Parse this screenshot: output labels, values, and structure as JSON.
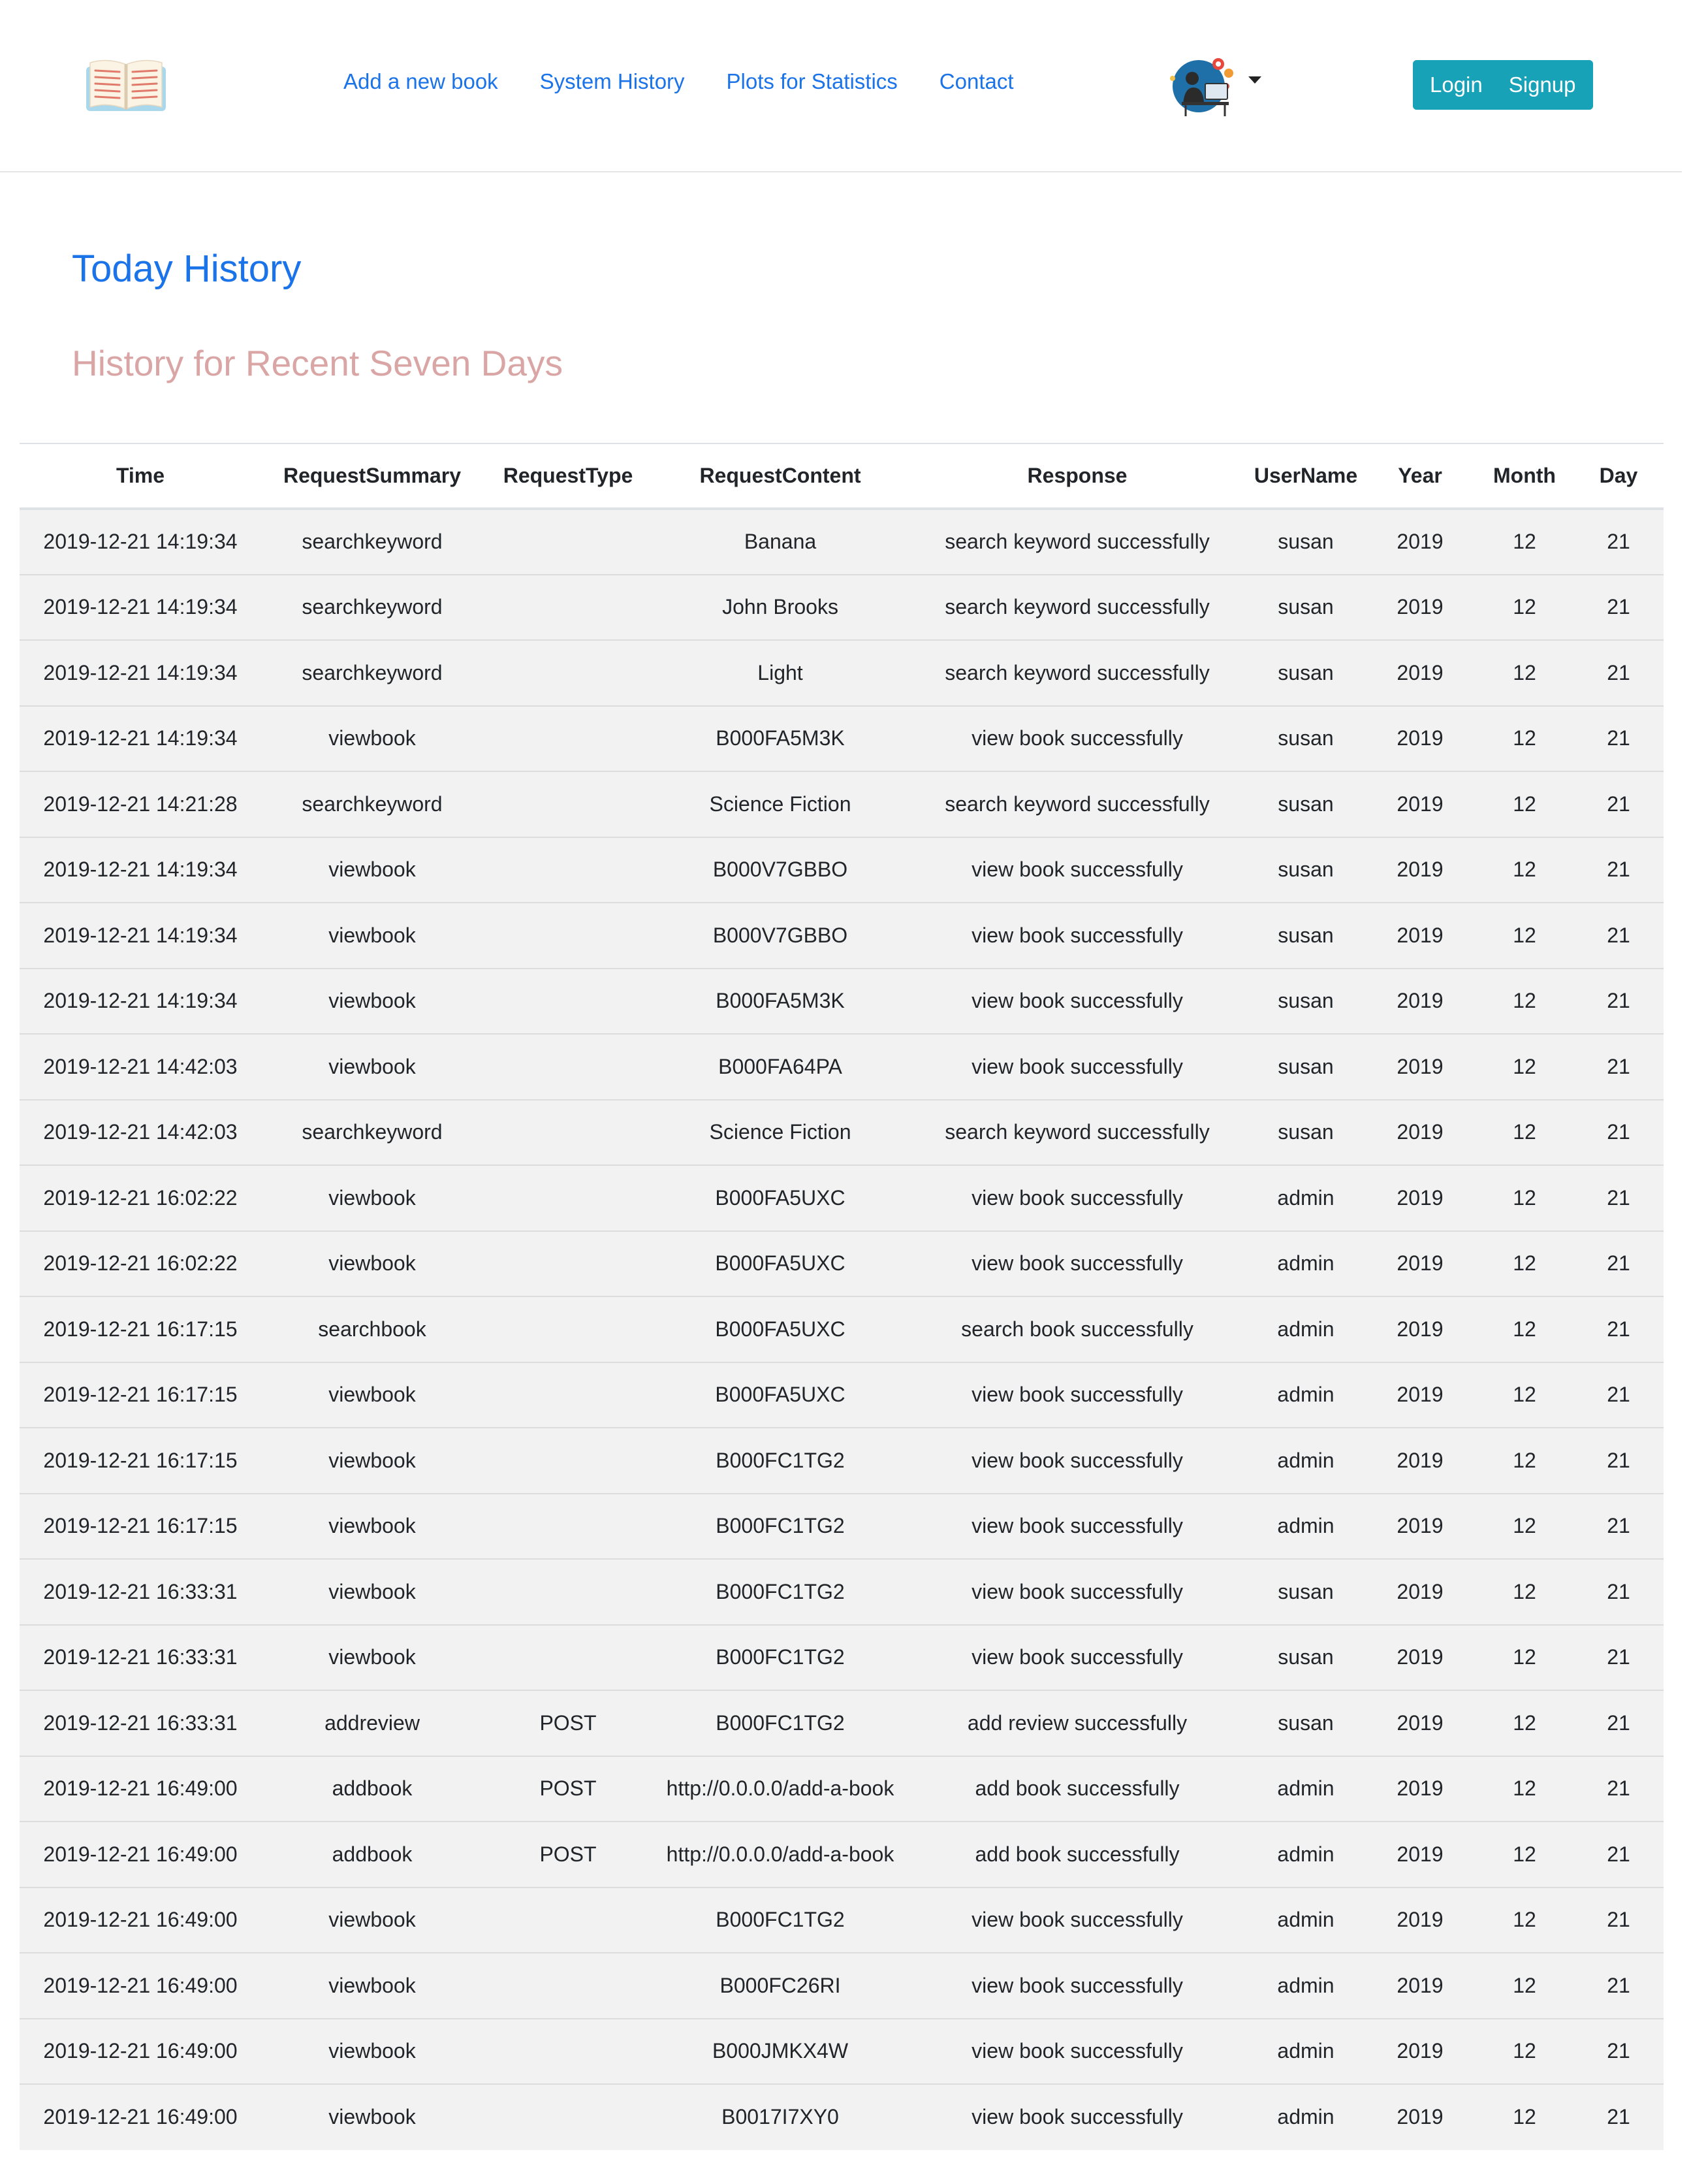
{
  "nav": {
    "links": [
      "Add a new book",
      "System History",
      "Plots for Statistics",
      "Contact"
    ],
    "login_label": "Login",
    "signup_label": "Signup"
  },
  "headings": {
    "today": "Today History",
    "recent": "History for Recent Seven Days"
  },
  "table": {
    "columns": [
      "Time",
      "RequestSummary",
      "RequestType",
      "RequestContent",
      "Response",
      "UserName",
      "Year",
      "Month",
      "Day"
    ],
    "rows": [
      [
        "2019-12-21 14:19:34",
        "searchkeyword",
        "",
        "Banana",
        "search keyword successfully",
        "susan",
        "2019",
        "12",
        "21"
      ],
      [
        "2019-12-21 14:19:34",
        "searchkeyword",
        "",
        "John Brooks",
        "search keyword successfully",
        "susan",
        "2019",
        "12",
        "21"
      ],
      [
        "2019-12-21 14:19:34",
        "searchkeyword",
        "",
        "Light",
        "search keyword successfully",
        "susan",
        "2019",
        "12",
        "21"
      ],
      [
        "2019-12-21 14:19:34",
        "viewbook",
        "",
        "B000FA5M3K",
        "view book successfully",
        "susan",
        "2019",
        "12",
        "21"
      ],
      [
        "2019-12-21 14:21:28",
        "searchkeyword",
        "",
        "Science Fiction",
        "search keyword successfully",
        "susan",
        "2019",
        "12",
        "21"
      ],
      [
        "2019-12-21 14:19:34",
        "viewbook",
        "",
        "B000V7GBBO",
        "view book successfully",
        "susan",
        "2019",
        "12",
        "21"
      ],
      [
        "2019-12-21 14:19:34",
        "viewbook",
        "",
        "B000V7GBBO",
        "view book successfully",
        "susan",
        "2019",
        "12",
        "21"
      ],
      [
        "2019-12-21 14:19:34",
        "viewbook",
        "",
        "B000FA5M3K",
        "view book successfully",
        "susan",
        "2019",
        "12",
        "21"
      ],
      [
        "2019-12-21 14:42:03",
        "viewbook",
        "",
        "B000FA64PA",
        "view book successfully",
        "susan",
        "2019",
        "12",
        "21"
      ],
      [
        "2019-12-21 14:42:03",
        "searchkeyword",
        "",
        "Science Fiction",
        "search keyword successfully",
        "susan",
        "2019",
        "12",
        "21"
      ],
      [
        "2019-12-21 16:02:22",
        "viewbook",
        "",
        "B000FA5UXC",
        "view book successfully",
        "admin",
        "2019",
        "12",
        "21"
      ],
      [
        "2019-12-21 16:02:22",
        "viewbook",
        "",
        "B000FA5UXC",
        "view book successfully",
        "admin",
        "2019",
        "12",
        "21"
      ],
      [
        "2019-12-21 16:17:15",
        "searchbook",
        "",
        "B000FA5UXC",
        "search book successfully",
        "admin",
        "2019",
        "12",
        "21"
      ],
      [
        "2019-12-21 16:17:15",
        "viewbook",
        "",
        "B000FA5UXC",
        "view book successfully",
        "admin",
        "2019",
        "12",
        "21"
      ],
      [
        "2019-12-21 16:17:15",
        "viewbook",
        "",
        "B000FC1TG2",
        "view book successfully",
        "admin",
        "2019",
        "12",
        "21"
      ],
      [
        "2019-12-21 16:17:15",
        "viewbook",
        "",
        "B000FC1TG2",
        "view book successfully",
        "admin",
        "2019",
        "12",
        "21"
      ],
      [
        "2019-12-21 16:33:31",
        "viewbook",
        "",
        "B000FC1TG2",
        "view book successfully",
        "susan",
        "2019",
        "12",
        "21"
      ],
      [
        "2019-12-21 16:33:31",
        "viewbook",
        "",
        "B000FC1TG2",
        "view book successfully",
        "susan",
        "2019",
        "12",
        "21"
      ],
      [
        "2019-12-21 16:33:31",
        "addreview",
        "POST",
        "B000FC1TG2",
        "add review successfully",
        "susan",
        "2019",
        "12",
        "21"
      ],
      [
        "2019-12-21 16:49:00",
        "addbook",
        "POST",
        "http://0.0.0.0/add-a-book",
        "add book successfully",
        "admin",
        "2019",
        "12",
        "21"
      ],
      [
        "2019-12-21 16:49:00",
        "addbook",
        "POST",
        "http://0.0.0.0/add-a-book",
        "add book successfully",
        "admin",
        "2019",
        "12",
        "21"
      ],
      [
        "2019-12-21 16:49:00",
        "viewbook",
        "",
        "B000FC1TG2",
        "view book successfully",
        "admin",
        "2019",
        "12",
        "21"
      ],
      [
        "2019-12-21 16:49:00",
        "viewbook",
        "",
        "B000FC26RI",
        "view book successfully",
        "admin",
        "2019",
        "12",
        "21"
      ],
      [
        "2019-12-21 16:49:00",
        "viewbook",
        "",
        "B000JMKX4W",
        "view book successfully",
        "admin",
        "2019",
        "12",
        "21"
      ],
      [
        "2019-12-21 16:49:00",
        "viewbook",
        "",
        "B0017I7XY0",
        "view book successfully",
        "admin",
        "2019",
        "12",
        "21"
      ]
    ]
  }
}
